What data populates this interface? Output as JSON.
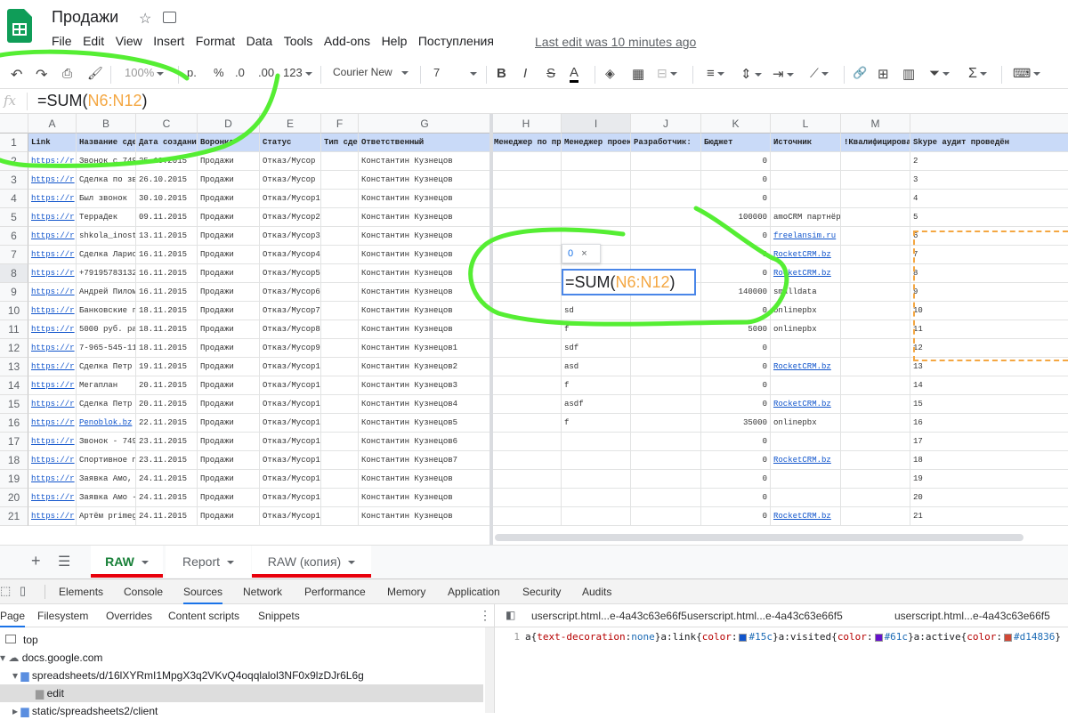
{
  "app": {
    "title": "Продажи",
    "last_edit": "Last edit was 10 minutes ago"
  },
  "menu": [
    "File",
    "Edit",
    "View",
    "Insert",
    "Format",
    "Data",
    "Tools",
    "Add-ons",
    "Help",
    "Поступления"
  ],
  "toolbar": {
    "zoom": "100%",
    "currency": "р.",
    "percent": "%",
    "dec_less": ".0",
    "dec_more": ".00",
    "number_format": "123",
    "font": "Courier New",
    "size": "7",
    "bold": "B",
    "italic": "I",
    "strike": "S",
    "text_color": "A",
    "sum": "Σ"
  },
  "formula_bar": {
    "fx": "fx",
    "prefix": "=SUM(",
    "range": "N6:N12",
    "suffix": ")"
  },
  "columns": [
    "A",
    "B",
    "C",
    "D",
    "E",
    "F",
    "G",
    "H",
    "I",
    "J",
    "K",
    "L",
    "M"
  ],
  "header_row": [
    "Link",
    "Название сде",
    "Дата создани",
    "Воронка",
    "Статус",
    "Тип сде",
    "Ответственный",
    "Менеджер по пр",
    "Менеджер проек",
    "Разработчик:",
    "Бюджет",
    "Источник",
    "!Квалифицирова",
    "Skype аудит проведён"
  ],
  "rows": [
    {
      "n": "1"
    },
    {
      "n": "2",
      "a": "https://r",
      "b": "Звонок с 749",
      "c": "25.10.2015",
      "d": "Продажи",
      "e": "Отказ/Мусор",
      "g": "Константин Кузнецов",
      "k": "0"
    },
    {
      "n": "3",
      "a": "https://r",
      "b": "Сделка по зв",
      "c": "26.10.2015",
      "d": "Продажи",
      "e": "Отказ/Мусор",
      "g": "Константин Кузнецов",
      "k": "0"
    },
    {
      "n": "4",
      "a": "https://r",
      "b": "Был звонок",
      "c": "30.10.2015",
      "d": "Продажи",
      "e": "Отказ/Мусор1",
      "g": "Константин Кузнецов",
      "k": "0"
    },
    {
      "n": "5",
      "a": "https://r",
      "b": "ТеррaДек",
      "c": "09.11.2015",
      "d": "Продажи",
      "e": "Отказ/Мусор2",
      "g": "Константин Кузнецов",
      "k": "100000",
      "l": "amoCRM партнёрка"
    },
    {
      "n": "6",
      "a": "https://r",
      "b": "shkola_inost",
      "c": "13.11.2015",
      "d": "Продажи",
      "e": "Отказ/Мусор3",
      "g": "Константин Кузнецов",
      "k": "0",
      "l": "freelansim.ru",
      "llink": true
    },
    {
      "n": "7",
      "a": "https://r",
      "b": "Сделка Ларис",
      "c": "16.11.2015",
      "d": "Продажи",
      "e": "Отказ/Мусор4",
      "g": "Константин Кузнецов",
      "k": "0",
      "l": "RocketCRM.bz",
      "llink": true
    },
    {
      "n": "8",
      "a": "https://r",
      "b": "+79195783132",
      "c": "16.11.2015",
      "d": "Продажи",
      "e": "Отказ/Мусор5",
      "g": "Константин Кузнецов",
      "k": "0",
      "l": "RocketCRM.bz",
      "llink": true
    },
    {
      "n": "9",
      "a": "https://r",
      "b": "Андрей Пилом",
      "c": "16.11.2015",
      "d": "Продажи",
      "e": "Отказ/Мусор6",
      "g": "Константин Кузнецов",
      "i": "df",
      "k": "140000",
      "l": "smalldata"
    },
    {
      "n": "10",
      "a": "https://r",
      "b": "Банковские г",
      "c": "18.11.2015",
      "d": "Продажи",
      "e": "Отказ/Мусор7",
      "g": "Константин Кузнецов",
      "i": "sd",
      "k": "0",
      "l": "onlinepbx"
    },
    {
      "n": "11",
      "a": "https://r",
      "b": "5000 руб. ра",
      "c": "18.11.2015",
      "d": "Продажи",
      "e": "Отказ/Мусор8",
      "g": "Константин Кузнецов",
      "i": "f",
      "k": "5000",
      "l": "onlinepbx"
    },
    {
      "n": "12",
      "a": "https://r",
      "b": "7-965-545-11",
      "c": "18.11.2015",
      "d": "Продажи",
      "e": "Отказ/Мусор9",
      "g": "Константин Кузнецов1",
      "i": "sdf",
      "k": "0"
    },
    {
      "n": "13",
      "a": "https://r",
      "b": "Сделка Петр",
      "c": "19.11.2015",
      "d": "Продажи",
      "e": "Отказ/Мусор10",
      "g": "Константин Кузнецов2",
      "i": "asd",
      "k": "0",
      "l": "RocketCRM.bz",
      "llink": true
    },
    {
      "n": "14",
      "a": "https://r",
      "b": "Мегаплан",
      "c": "20.11.2015",
      "d": "Продажи",
      "e": "Отказ/Мусор11",
      "g": "Константин Кузнецов3",
      "i": "f",
      "k": "0"
    },
    {
      "n": "15",
      "a": "https://r",
      "b": "Сделка Петр",
      "c": "20.11.2015",
      "d": "Продажи",
      "e": "Отказ/Мусор12",
      "g": "Константин Кузнецов4",
      "i": "asdf",
      "k": "0",
      "l": "RocketCRM.bz",
      "llink": true
    },
    {
      "n": "16",
      "a": "https://r",
      "b": "Penoblok.bz",
      "blink": true,
      "c": "22.11.2015",
      "d": "Продажи",
      "e": "Отказ/Мусор13",
      "g": "Константин Кузнецов5",
      "i": "f",
      "k": "35000",
      "l": "onlinepbx"
    },
    {
      "n": "17",
      "a": "https://r",
      "b": "Звонок - 749",
      "c": "23.11.2015",
      "d": "Продажи",
      "e": "Отказ/Мусор14",
      "g": "Константин Кузнецов6",
      "k": "0"
    },
    {
      "n": "18",
      "a": "https://r",
      "b": "Спортивное п",
      "c": "23.11.2015",
      "d": "Продажи",
      "e": "Отказ/Мусор15",
      "g": "Константин Кузнецов7",
      "k": "0",
      "l": "RocketCRM.bz",
      "llink": true
    },
    {
      "n": "19",
      "a": "https://r",
      "b": "Заявка Амо,",
      "c": "24.11.2015",
      "d": "Продажи",
      "e": "Отказ/Мусор16",
      "g": "Константин Кузнецов",
      "k": "0"
    },
    {
      "n": "20",
      "a": "https://r",
      "b": "Заявка Амо -",
      "c": "24.11.2015",
      "d": "Продажи",
      "e": "Отказ/Мусор17",
      "g": "Константин Кузнецов",
      "k": "0"
    },
    {
      "n": "21",
      "a": "https://r",
      "b": "Артём primeg",
      "c": "24.11.2015",
      "d": "Продажи",
      "e": "Отказ/Мусор18",
      "g": "Константин Кузнецов",
      "k": "0",
      "l": "RocketCRM.bz",
      "llink": true
    }
  ],
  "editor": {
    "tooltip_value": "0",
    "tooltip_close": "×",
    "prefix": "=SUM(",
    "range": "N6:N12",
    "suffix": ")"
  },
  "sheets": [
    {
      "label": "RAW",
      "active": true
    },
    {
      "label": "Report",
      "active": false
    },
    {
      "label": "RAW (копия)",
      "active": false
    }
  ],
  "devtools": {
    "tabs": [
      "Elements",
      "Console",
      "Sources",
      "Network",
      "Performance",
      "Memory",
      "Application",
      "Security",
      "Audits"
    ],
    "active_tab": "Sources",
    "source_tabs": [
      "Page",
      "Filesystem",
      "Overrides",
      "Content scripts",
      "Snippets"
    ],
    "tree": [
      "top",
      "docs.google.com",
      "spreadsheets/d/16lXYRmI1MpgX3q2VKvQ4oqqlalol3NF0x9lzDJr6L6g",
      "edit",
      "static/spreadsheets2/client"
    ],
    "editor_tabs": [
      "userscript.html...e-4a43c63e66f5",
      "userscript.html...e-4a43c63e66f5",
      "userscript.html...e-4a43c63e66f5"
    ],
    "line_no": "1",
    "code": {
      "p1": "a{",
      "k1": "text-decoration",
      ":1": ":",
      "v1": "none",
      "p2": "}a:link{",
      "k2": "color",
      ":2": ":",
      "c2": "#15c",
      "p3": "}a:visited{",
      "k3": "color",
      ":3": ":",
      "c3": "#61c",
      "p4": "}a:active{",
      "k4": "color",
      ":4": ":",
      "c4": "#d14836",
      "p5": "}"
    }
  },
  "colors": {
    "sheets_green": "#0f9d58",
    "header_blue": "#c9daf8",
    "link": "#1155cc",
    "tab_red": "#e8000b",
    "annotation": "#55ee33",
    "range": "#f4a742",
    "dashed": "#f4a742"
  }
}
